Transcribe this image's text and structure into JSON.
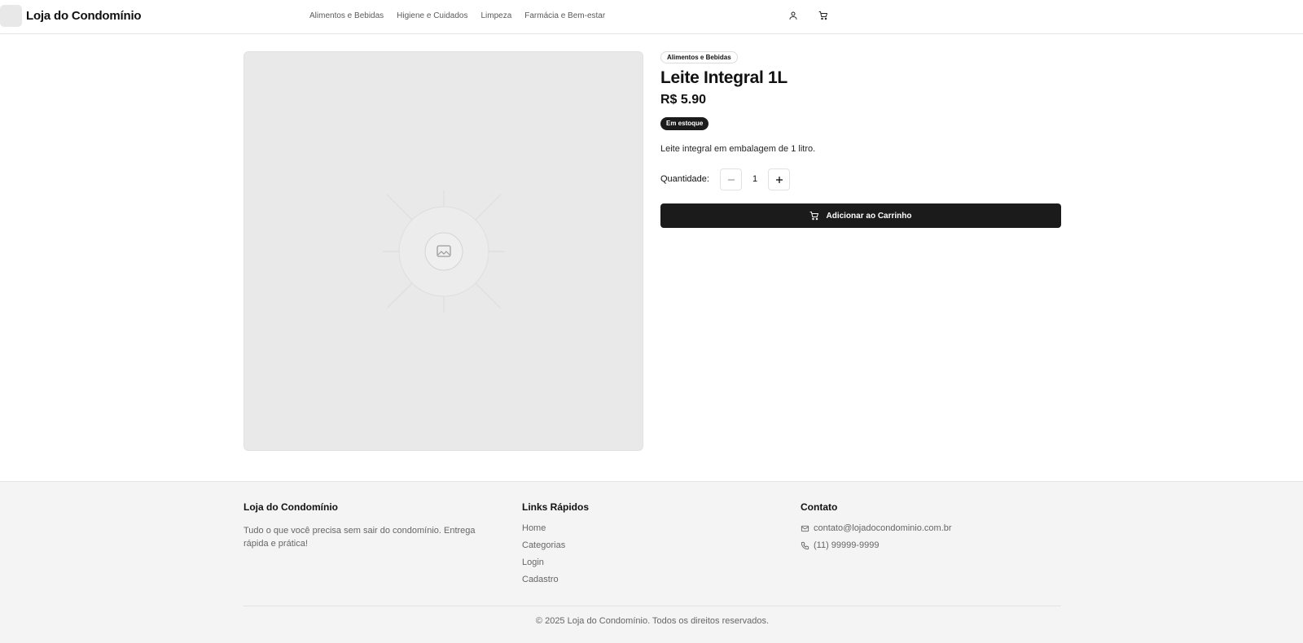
{
  "header": {
    "brand": "Loja do Condomínio",
    "nav": [
      "Alimentos e Bebidas",
      "Higiene e Cuidados",
      "Limpeza",
      "Farmácia e Bem-estar"
    ],
    "icons": [
      "user-icon",
      "cart-icon"
    ]
  },
  "product": {
    "category": "Alimentos e Bebidas",
    "title": "Leite Integral 1L",
    "price": "R$ 5.90",
    "stock": "Em estoque",
    "description": "Leite integral em embalagem de 1 litro.",
    "quantity_label": "Quantidade:",
    "quantity": "1",
    "add_to_cart": "Adicionar ao Carrinho"
  },
  "footer": {
    "about": {
      "heading": "Loja do Condomínio",
      "text": "Tudo o que você precisa sem sair do condomínio. Entrega rápida e prática!"
    },
    "links": {
      "heading": "Links Rápidos",
      "items": [
        "Home",
        "Categorias",
        "Login",
        "Cadastro"
      ]
    },
    "contact": {
      "heading": "Contato",
      "email": "contato@lojadocondominio.com.br",
      "phone": "(11) 99999-9999"
    },
    "copyright": "© 2025 Loja do Condomínio. Todos os direitos reservados."
  },
  "colors": {
    "primary": "#1b1b1b",
    "muted_text": "#666666",
    "image_bg": "#e9e9e9",
    "footer_bg": "#f4f4f4"
  }
}
